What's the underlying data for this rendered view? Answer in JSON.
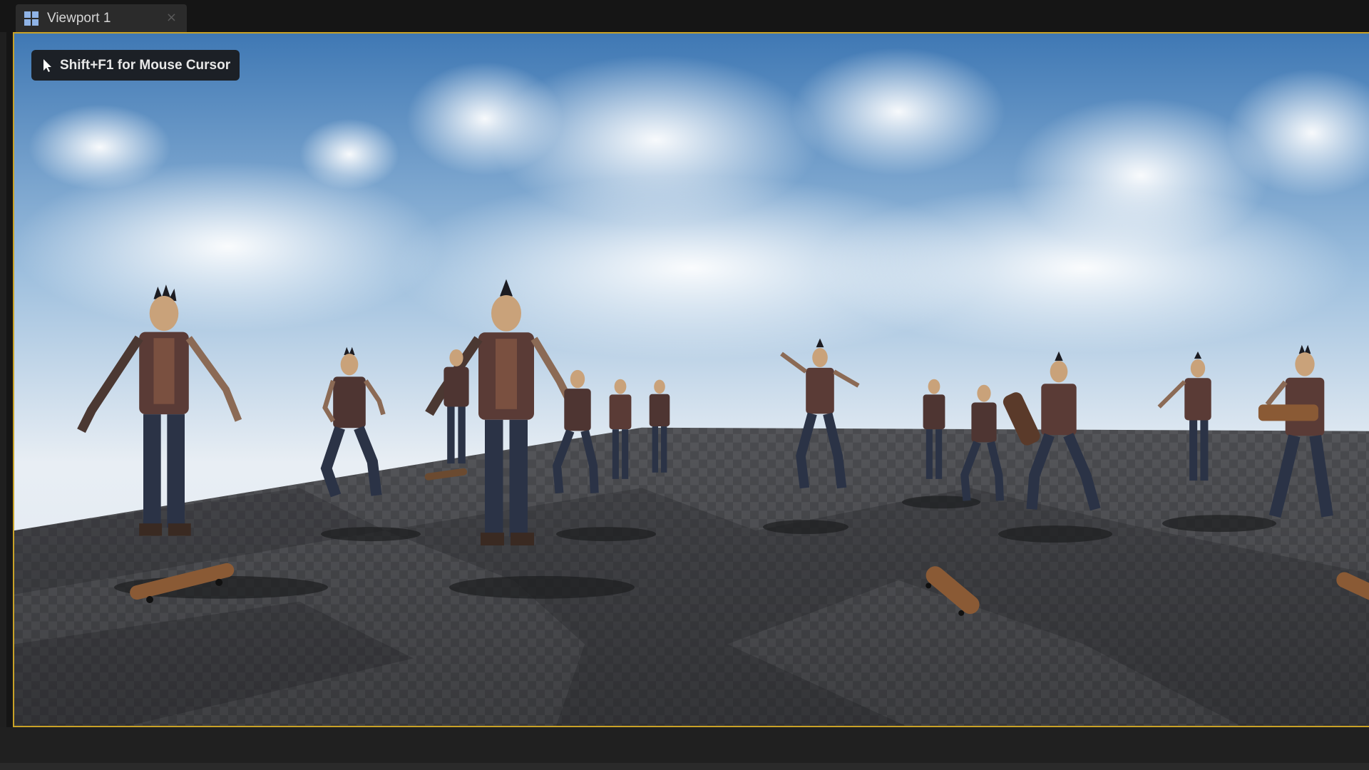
{
  "tab": {
    "icon": "viewport-grid-icon",
    "label": "Viewport 1",
    "close_icon": "close-icon"
  },
  "viewport": {
    "hint_icon": "mouse-cursor-icon",
    "hint_text": "Shift+F1 for Mouse Cursor",
    "border_color": "#c9a227",
    "scene_description_kind": "3d-scene-skeleton-punk-crowd-on-checkered-floor"
  },
  "colors": {
    "editor_bg": "#151515",
    "tab_bg": "#2b2b2b",
    "sky_top": "#3f78b4",
    "floor_dark": "#3a3a3c",
    "floor_light": "#55565a"
  }
}
